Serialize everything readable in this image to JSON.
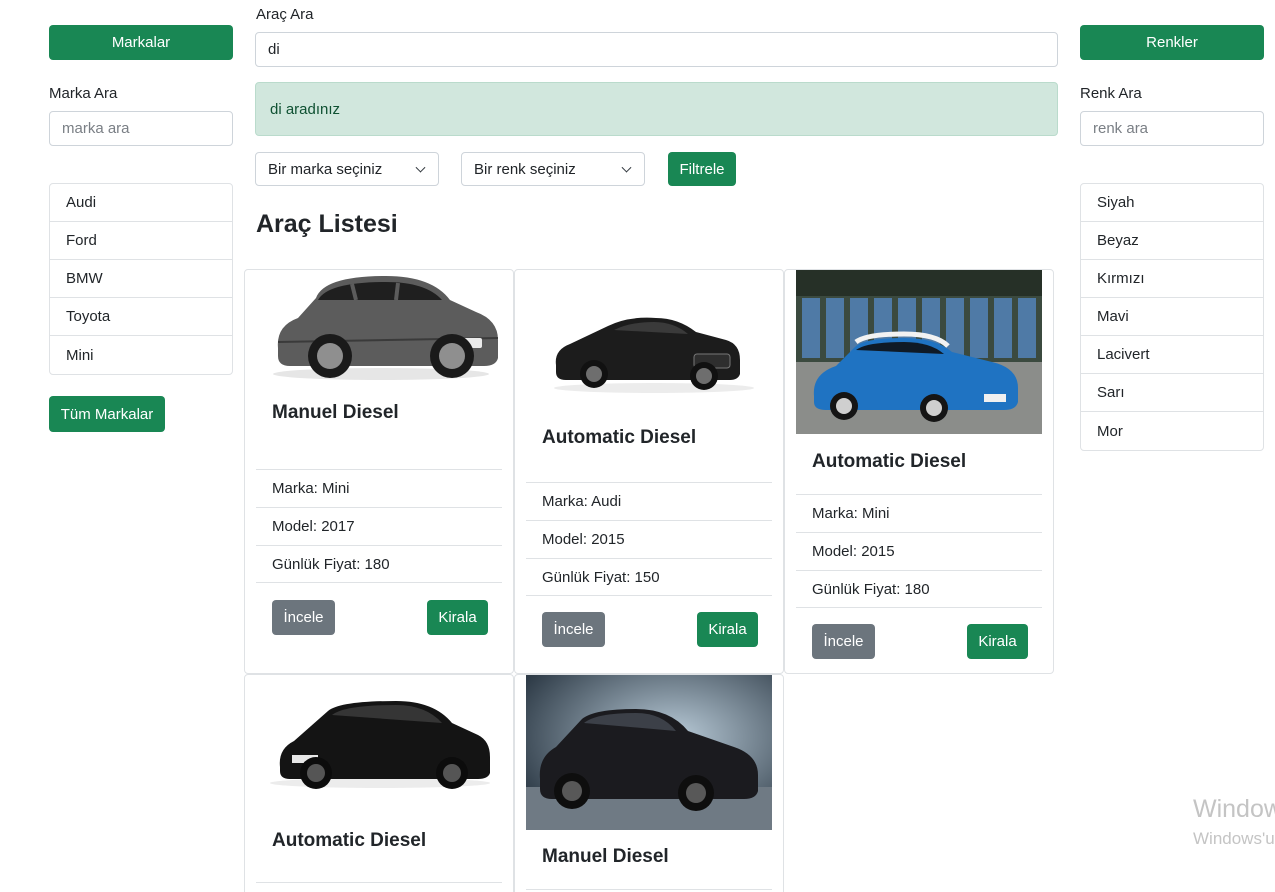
{
  "left_panel": {
    "brands_button": "Markalar",
    "search_label": "Marka Ara",
    "search_placeholder": "marka ara",
    "items": [
      {
        "label": "Audi"
      },
      {
        "label": "Ford"
      },
      {
        "label": "BMW"
      },
      {
        "label": "Toyota"
      },
      {
        "label": "Mini"
      }
    ],
    "all_brands_button": "Tüm Markalar"
  },
  "right_panel": {
    "colors_button": "Renkler",
    "search_label": "Renk Ara",
    "search_placeholder": "renk ara",
    "items": [
      {
        "label": "Siyah"
      },
      {
        "label": "Beyaz"
      },
      {
        "label": "Kırmızı"
      },
      {
        "label": "Mavi"
      },
      {
        "label": "Lacivert"
      },
      {
        "label": "Sarı"
      },
      {
        "label": "Mor"
      }
    ]
  },
  "main": {
    "search_label": "Araç Ara",
    "search_value": "di",
    "alert_text": "di aradınız",
    "brand_select": "Bir marka seçiniz",
    "color_select": "Bir renk seçiniz",
    "filter_button": "Filtrele",
    "list_heading": "Araç Listesi"
  },
  "cars": [
    {
      "title": "Manuel Diesel",
      "brand": "Marka: Mini",
      "model": "Model: 2017",
      "price": "Günlük Fiyat: 180",
      "details_button": "İncele",
      "rent_button": "Kirala",
      "image": "grey-mini-cooper"
    },
    {
      "title": "Automatic Diesel",
      "brand": "Marka: Audi",
      "model": "Model: 2015",
      "price": "Günlük Fiyat: 150",
      "details_button": "İncele",
      "rent_button": "Kirala",
      "image": "black-audi-sedan"
    },
    {
      "title": "Automatic Diesel",
      "brand": "Marka: Mini",
      "model": "Model: 2015",
      "price": "Günlük Fiyat: 180",
      "details_button": "İncele",
      "rent_button": "Kirala",
      "image": "blue-mini-cooper"
    },
    {
      "title": "Automatic Diesel",
      "image": "black-bmw-hatchback"
    },
    {
      "title": "Manuel Diesel",
      "image": "black-ford-fiesta"
    }
  ],
  "watermark": {
    "line1": "Window",
    "line2": "Windows'u"
  }
}
